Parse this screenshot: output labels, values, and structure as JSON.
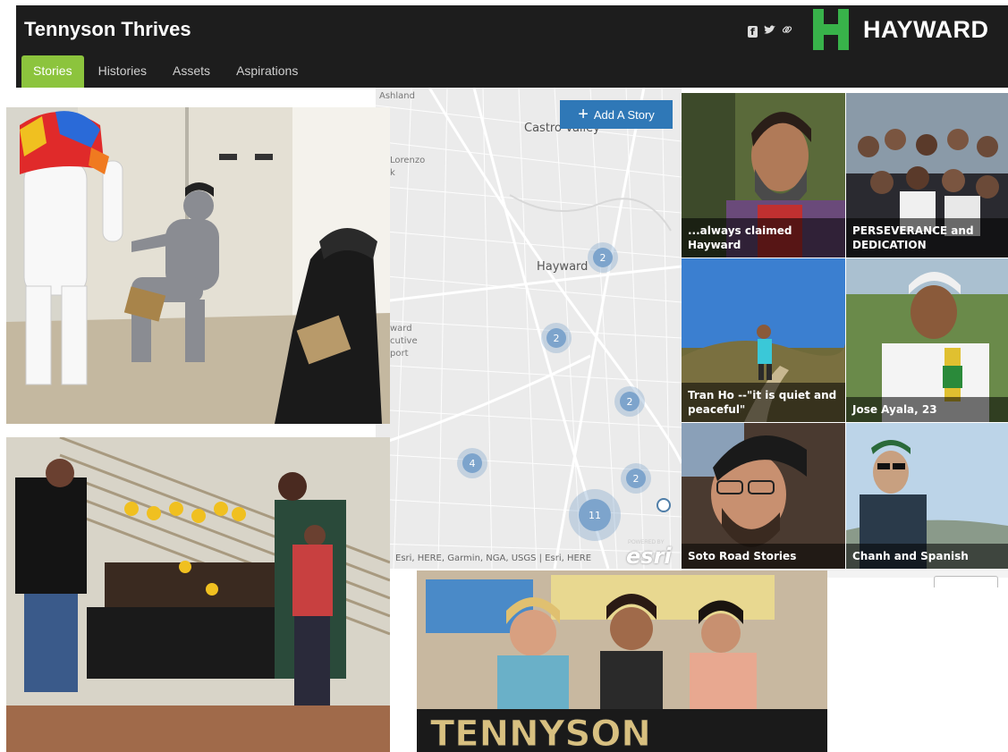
{
  "header": {
    "title": "Tennyson Thrives",
    "logo_text": "HAYWARD",
    "social": [
      "f",
      "t",
      "link"
    ],
    "tabs": [
      {
        "label": "Stories",
        "active": true
      },
      {
        "label": "Histories",
        "active": false
      },
      {
        "label": "Assets",
        "active": false
      },
      {
        "label": "Aspirations",
        "active": false
      }
    ]
  },
  "map": {
    "add_story_label": "Add A Story",
    "places": {
      "ashland": "Ashland",
      "castro_valley": "Castro Valley",
      "hayward": "Hayward",
      "lorenzo": "Lorenzo",
      "lorenzo_k": "k",
      "ward": "ward",
      "cutive": "cutive",
      "port": "port"
    },
    "clusters": [
      "2",
      "2",
      "2",
      "4",
      "2",
      "11"
    ],
    "attribution": "Esri, HERE, Garmin, NGA, USGS | Esri, HERE",
    "esri_powered": "POWERED BY",
    "esri_logo": "esri"
  },
  "stories": [
    {
      "label": "...always claimed Hayward"
    },
    {
      "label": "PERSEVERANCE and DEDICATION"
    },
    {
      "label": "Tran Ho --\"it is quiet and peaceful\""
    },
    {
      "label": "Jose Ayala, 23"
    },
    {
      "label": "Soto Road Stories"
    },
    {
      "label": "Chanh and Spanish"
    }
  ],
  "photos": {
    "banner_text": "TENNYSON"
  },
  "colors": {
    "header_bg": "#1d1d1d",
    "active_tab": "#8cc43d",
    "logo_green": "#38b24a",
    "add_story_bg": "#2f78b7",
    "cluster": "#7da4cc"
  }
}
